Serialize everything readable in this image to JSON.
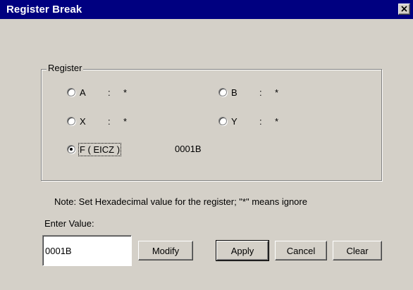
{
  "window": {
    "title": "Register Break",
    "close_glyph": "✕"
  },
  "group": {
    "label": "Register"
  },
  "registers": [
    {
      "label": "A",
      "sep": ":",
      "value": "*",
      "checked": false
    },
    {
      "label": "B",
      "sep": ":",
      "value": "*",
      "checked": false
    },
    {
      "label": "X",
      "sep": ":",
      "value": "*",
      "checked": false
    },
    {
      "label": "Y",
      "sep": ":",
      "value": "*",
      "checked": false
    },
    {
      "label": "F ( EICZ )",
      "value": "0001B",
      "checked": true
    }
  ],
  "note": "Note: Set Hexadecimal value for the register; \"*\" means ignore",
  "input": {
    "label": "Enter Value:",
    "value": "0001B"
  },
  "buttons": {
    "modify": "Modify",
    "apply": "Apply",
    "cancel": "Cancel",
    "clear": "Clear"
  },
  "colors": {
    "titlebar": "#000080",
    "face": "#d4d0c8"
  }
}
